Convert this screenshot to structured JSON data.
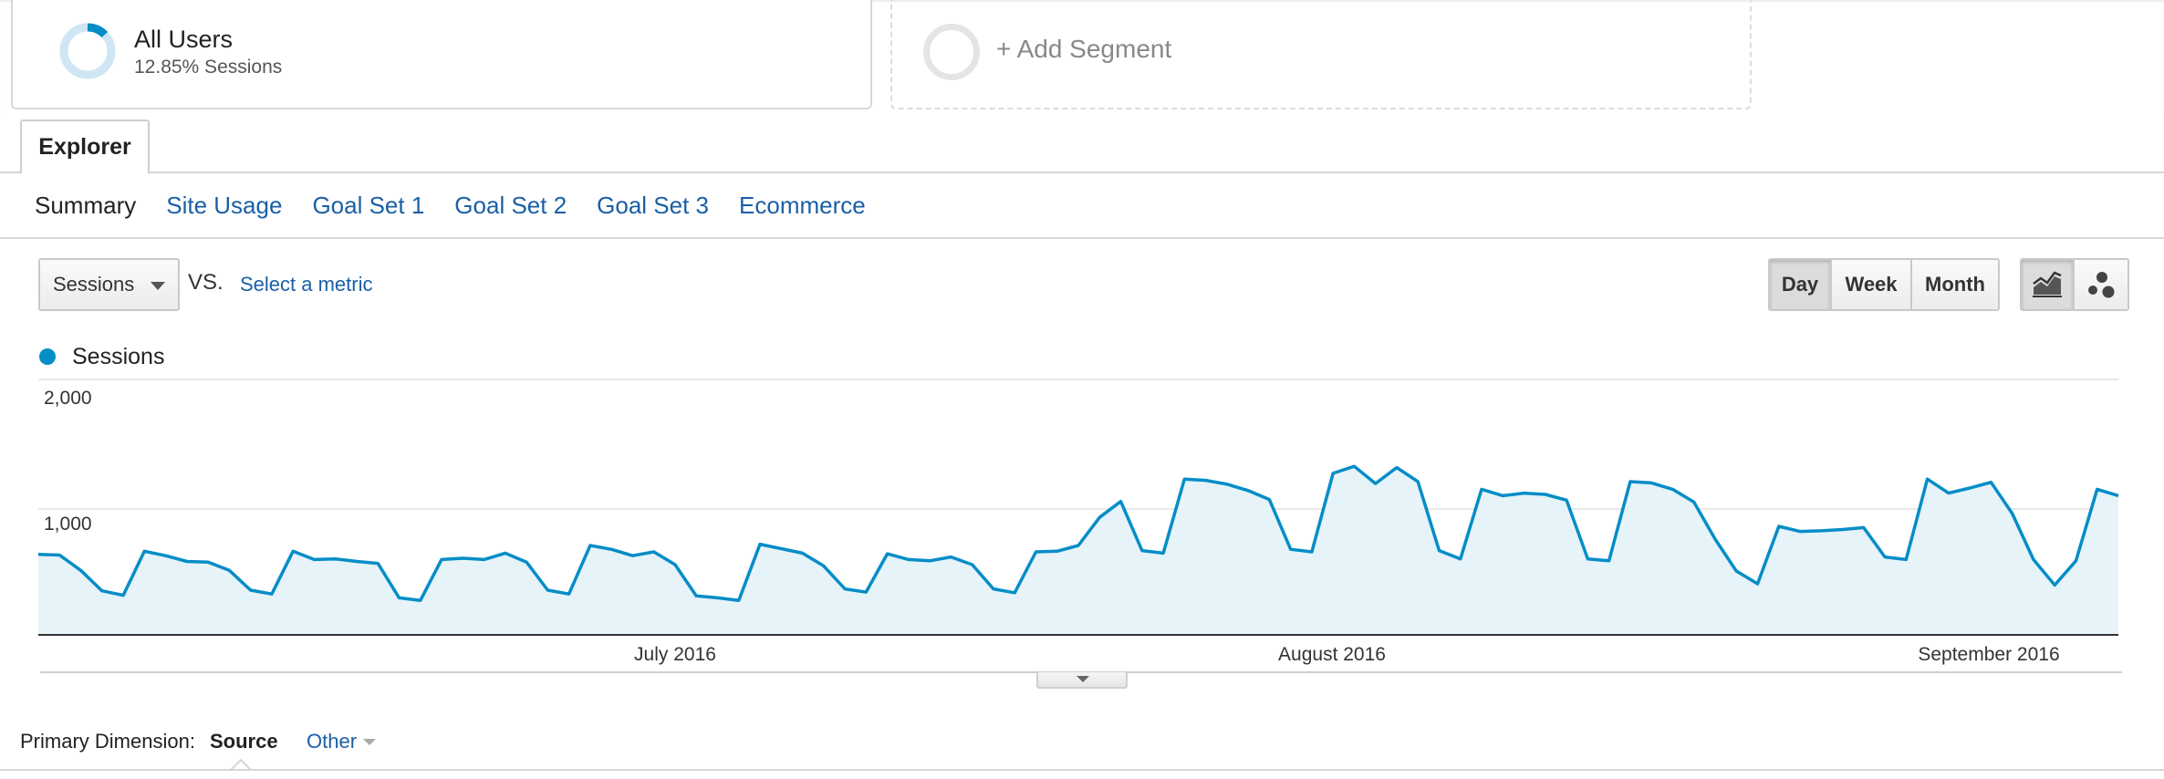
{
  "segments": {
    "active": {
      "title": "All Users",
      "subtitle": "12.85% Sessions",
      "percent": 12.85,
      "color": "#058dc7"
    },
    "add_label": "+ Add Segment"
  },
  "explorer_tab": "Explorer",
  "subnav": [
    {
      "label": "Summary",
      "active": true
    },
    {
      "label": "Site Usage",
      "active": false
    },
    {
      "label": "Goal Set 1",
      "active": false
    },
    {
      "label": "Goal Set 2",
      "active": false
    },
    {
      "label": "Goal Set 3",
      "active": false
    },
    {
      "label": "Ecommerce",
      "active": false
    }
  ],
  "controls": {
    "metric_select": "Sessions",
    "vs_label": "VS.",
    "select_metric_link": "Select a metric",
    "period": {
      "day": "Day",
      "week": "Week",
      "month": "Month",
      "selected": "Day"
    },
    "chart_type_icons": [
      "line-chart-icon",
      "motion-chart-icon"
    ]
  },
  "legend": {
    "label": "Sessions",
    "color": "#058dc7"
  },
  "chart_data": {
    "type": "area",
    "series": [
      {
        "name": "Sessions",
        "color": "#058dc7",
        "fill": "#e6f3f9",
        "values": [
          630,
          625,
          505,
          345,
          310,
          655,
          620,
          575,
          570,
          505,
          350,
          320,
          655,
          590,
          595,
          575,
          560,
          290,
          270,
          590,
          600,
          590,
          640,
          570,
          350,
          320,
          700,
          670,
          620,
          650,
          550,
          305,
          290,
          270,
          710,
          675,
          640,
          540,
          360,
          335,
          635,
          590,
          580,
          610,
          550,
          360,
          330,
          650,
          655,
          700,
          920,
          1045,
          660,
          640,
          1220,
          1210,
          1180,
          1130,
          1060,
          670,
          650,
          1265,
          1320,
          1185,
          1310,
          1200,
          660,
          595,
          1140,
          1090,
          1110,
          1100,
          1055,
          595,
          580,
          1200,
          1190,
          1140,
          1040,
          750,
          500,
          400,
          850,
          810,
          815,
          825,
          840,
          610,
          590,
          1220,
          1110,
          1150,
          1195,
          950,
          590,
          390,
          580,
          1140,
          1090
        ]
      }
    ],
    "y_ticks": [
      "2,000",
      "1,000"
    ],
    "ylim": [
      0,
      2000
    ],
    "x_labels": [
      "July 2016",
      "August 2016",
      "September 2016"
    ],
    "grid": true
  },
  "primary_dimension": {
    "label": "Primary Dimension:",
    "selected": "Source",
    "other": "Other"
  }
}
